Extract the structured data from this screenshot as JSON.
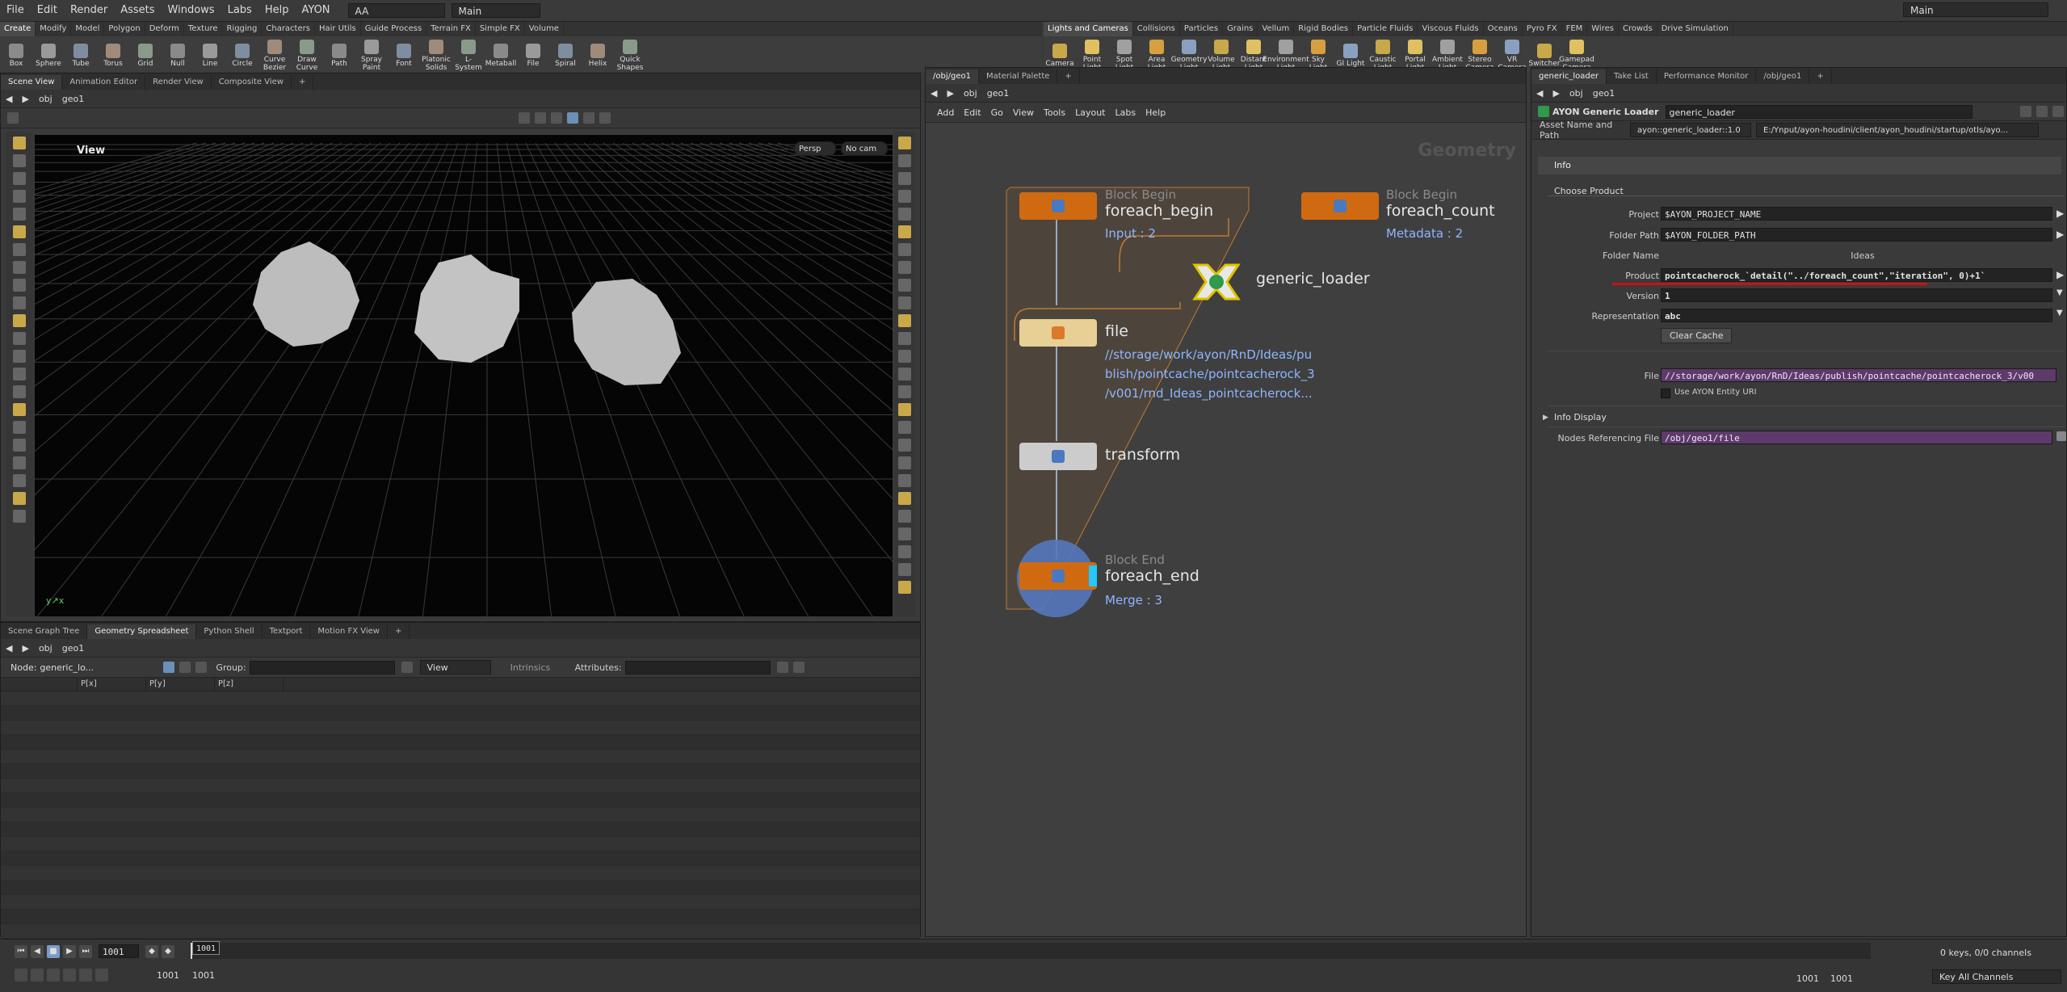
{
  "menubar": {
    "items": [
      "File",
      "Edit",
      "Render",
      "Assets",
      "Windows",
      "Labs",
      "Help",
      "AYON"
    ],
    "desktop": "AA",
    "context": "Main",
    "right_desktop": "Main"
  },
  "shelf_left": {
    "tabs": [
      "Create",
      "Modify",
      "Model",
      "Polygon",
      "Deform",
      "Texture",
      "Rigging",
      "Characters",
      "Hair Utils",
      "Guide Process",
      "Terrain FX",
      "Simple FX",
      "Volume"
    ],
    "tools": [
      "Box",
      "Sphere",
      "Tube",
      "Torus",
      "Grid",
      "Null",
      "Line",
      "Circle",
      "Curve Bezier",
      "Draw Curve",
      "Path",
      "Spray Paint",
      "Font",
      "Platonic Solids",
      "L-System",
      "Metaball",
      "File",
      "Spiral",
      "Helix",
      "Quick Shapes"
    ]
  },
  "shelf_right": {
    "tabs": [
      "Lights and Cameras",
      "Collisions",
      "Particles",
      "Grains",
      "Vellum",
      "Rigid Bodies",
      "Particle Fluids",
      "Viscous Fluids",
      "Oceans",
      "Pyro FX",
      "FEM",
      "Wires",
      "Crowds",
      "Drive Simulation"
    ],
    "tools": [
      "Camera",
      "Point Light",
      "Spot Light",
      "Area Light",
      "Geometry Light",
      "Volume Light",
      "Distant Light",
      "Environment Light",
      "Sky Light",
      "GI Light",
      "Caustic Light",
      "Portal Light",
      "Ambient Light",
      "Stereo Camera",
      "VR Camera",
      "Switcher",
      "Gamepad Camera"
    ]
  },
  "left_pane": {
    "tabs": [
      "Scene View",
      "Animation Editor",
      "Render View",
      "Composite View"
    ],
    "path": [
      "obj",
      "geo1"
    ],
    "view_label": "View",
    "persp": "Persp",
    "cam": "No cam"
  },
  "spreadsheet_pane": {
    "tabs": [
      "Scene Graph Tree",
      "Geometry Spreadsheet",
      "Python Shell",
      "Textport",
      "Motion FX View"
    ],
    "path": [
      "obj",
      "geo1"
    ],
    "node_label": "Node:",
    "node_value": "generic_lo...",
    "group_label": "Group:",
    "view_dd": "View",
    "intrinsics": "Intrinsics",
    "attributes_label": "Attributes:",
    "columns": [
      "P[x]",
      "P[y]",
      "P[z]"
    ]
  },
  "network_pane": {
    "tabs": [
      "/obj/geo1",
      "Material Palette"
    ],
    "path": [
      "obj",
      "geo1"
    ],
    "menu": [
      "Add",
      "Edit",
      "Go",
      "View",
      "Tools",
      "Layout",
      "Labs",
      "Help"
    ],
    "context_label": "Geometry",
    "nodes": {
      "foreach_begin": {
        "tag": "Block Begin",
        "name": "foreach_begin",
        "sub": "Input : 2"
      },
      "foreach_count": {
        "tag": "Block Begin",
        "name": "foreach_count",
        "sub": "Metadata : 2"
      },
      "generic_loader": {
        "name": "generic_loader"
      },
      "file": {
        "name": "file",
        "path1": "//storage/work/ayon/RnD/Ideas/pu",
        "path2": "blish/pointcache/pointcacherock_3",
        "path3": "/v001/rnd_Ideas_pointcacherock..."
      },
      "transform": {
        "name": "transform"
      },
      "foreach_end": {
        "tag": "Block End",
        "name": "foreach_end",
        "sub": "Merge : 3"
      }
    }
  },
  "param_pane": {
    "tabs": [
      "generic_loader",
      "Take List",
      "Performance Monitor",
      "/obj/geo1"
    ],
    "path": [
      "obj",
      "geo1"
    ],
    "node_type": "AYON Generic Loader",
    "node_name": "generic_loader",
    "asset_label": "Asset Name and Path",
    "asset_value": "ayon::generic_loader::1.0",
    "asset_path": "E:/Ynput/ayon-houdini/client/ayon_houdini/startup/otls/ayo...",
    "info_tab": "Info",
    "choose_product": "Choose Product",
    "fields": {
      "project_label": "Project",
      "project_value": "$AYON_PROJECT_NAME",
      "folder_path_label": "Folder Path",
      "folder_path_value": "$AYON_FOLDER_PATH",
      "folder_name_label": "Folder Name",
      "folder_name_value": "Ideas",
      "product_label": "Product",
      "product_value": "pointcacherock_`detail(\"../foreach_count\",\"iteration\", 0)+1`",
      "version_label": "Version",
      "version_value": "1",
      "representation_label": "Representation",
      "representation_value": "abc",
      "clear_cache": "Clear Cache",
      "file_label": "File",
      "file_value": "//storage/work/ayon/RnD/Ideas/publish/pointcache/pointcacherock_3/v00",
      "use_entity_uri": "Use AYON Entity URI",
      "info_display": "Info Display",
      "nodes_ref_label": "Nodes Referencing File",
      "nodes_ref_value": "/obj/geo1/file"
    }
  },
  "timeline": {
    "frame": "1001",
    "frame_box": "1001",
    "start": "1001",
    "end": "1001",
    "range_start": "1001",
    "range_end": "1001",
    "keys": "0 keys, 0/0 channels",
    "key_all": "Key All Channels"
  },
  "colors": {
    "accent_red": "#cc1111",
    "node_orange": "#d06a10",
    "network_box": "#5a4a3a",
    "purple_field": "#5e3a6a",
    "label_blue": "#8fb6ff"
  }
}
